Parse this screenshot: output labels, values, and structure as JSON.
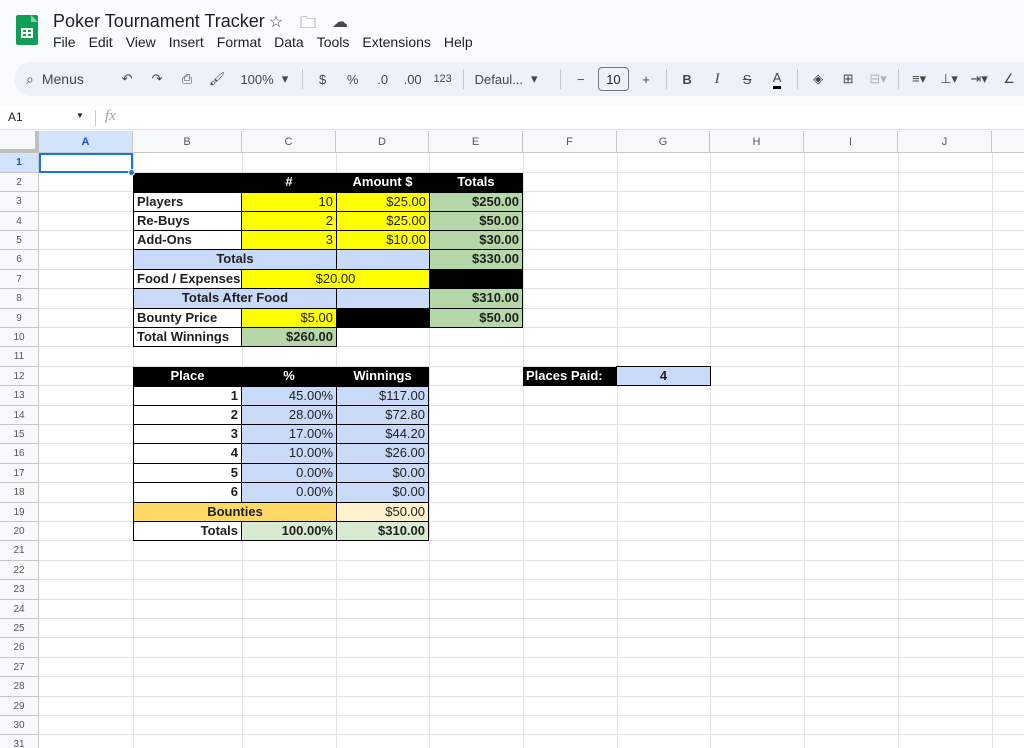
{
  "app": {
    "title": "Poker Tournament Tracker",
    "menus": [
      "File",
      "Edit",
      "View",
      "Insert",
      "Format",
      "Data",
      "Tools",
      "Extensions",
      "Help"
    ],
    "icons": [
      "star-icon",
      "move-folder-icon",
      "cloud-status-icon"
    ]
  },
  "toolbar": {
    "menus_label": "Menus",
    "zoom": "100%",
    "currency": "$",
    "percent": "%",
    "dec_decrease": ".0",
    "dec_increase": ".00",
    "number_format": "123",
    "font": "Defaul...",
    "font_size": "10",
    "bold": "B",
    "italic": "I",
    "strike": "S",
    "text_color": "A"
  },
  "formula_bar": {
    "cell_ref": "A1",
    "fx": "fx",
    "value": ""
  },
  "columns": [
    "A",
    "B",
    "C",
    "D",
    "E",
    "F",
    "G",
    "H",
    "I",
    "J"
  ],
  "rows": [
    "1",
    "2",
    "3",
    "4",
    "5",
    "6",
    "7",
    "8",
    "9",
    "10",
    "11",
    "12",
    "13",
    "14",
    "15",
    "16",
    "17",
    "18",
    "19",
    "20",
    "21",
    "22",
    "23",
    "24",
    "25",
    "26",
    "27",
    "28",
    "29",
    "30",
    "31"
  ],
  "buyin": {
    "header": [
      "",
      "#",
      "Amount $",
      "Totals"
    ],
    "rows": [
      {
        "label": "Players",
        "count": "10",
        "amount": "$25.00",
        "total": "$250.00"
      },
      {
        "label": "Re-Buys",
        "count": "2",
        "amount": "$25.00",
        "total": "$50.00"
      },
      {
        "label": "Add-Ons",
        "count": "3",
        "amount": "$10.00",
        "total": "$30.00"
      }
    ],
    "totals_label": "Totals",
    "totals_value": "$330.00",
    "food_label": "Food / Expenses",
    "food_value": "$20.00",
    "after_food_label": "Totals After Food",
    "after_food_value": "$310.00",
    "bounty_label": "Bounty Price",
    "bounty_value": "$5.00",
    "bounty_total": "$50.00",
    "winnings_label": "Total Winnings",
    "winnings_value": "$260.00"
  },
  "payout": {
    "header": [
      "Place",
      "%",
      "Winnings"
    ],
    "rows": [
      {
        "place": "1",
        "pct": "45.00%",
        "win": "$117.00"
      },
      {
        "place": "2",
        "pct": "28.00%",
        "win": "$72.80"
      },
      {
        "place": "3",
        "pct": "17.00%",
        "win": "$44.20"
      },
      {
        "place": "4",
        "pct": "10.00%",
        "win": "$26.00"
      },
      {
        "place": "5",
        "pct": "0.00%",
        "win": "$0.00"
      },
      {
        "place": "6",
        "pct": "0.00%",
        "win": "$0.00"
      }
    ],
    "bounties_label": "Bounties",
    "bounties_value": "$50.00",
    "totals_label": "Totals",
    "totals_pct": "100.00%",
    "totals_win": "$310.00"
  },
  "places_paid": {
    "label": "Places Paid:",
    "value": "4"
  }
}
